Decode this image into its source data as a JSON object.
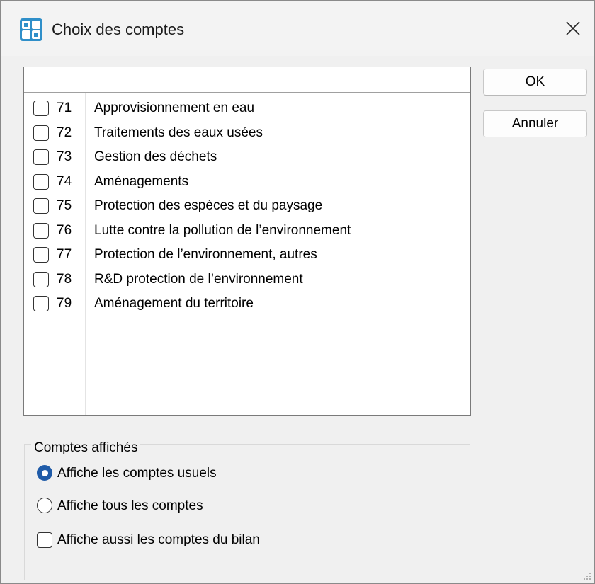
{
  "window": {
    "title": "Choix des comptes"
  },
  "accounts": [
    {
      "num": "71",
      "label": "Approvisionnement en eau",
      "checked": false
    },
    {
      "num": "72",
      "label": "Traitements des eaux usées",
      "checked": false
    },
    {
      "num": "73",
      "label": "Gestion des déchets",
      "checked": false
    },
    {
      "num": "74",
      "label": "Aménagements",
      "checked": false
    },
    {
      "num": "75",
      "label": "Protection des espèces et du paysage",
      "checked": false
    },
    {
      "num": "76",
      "label": "Lutte contre la pollution de l’environnement",
      "checked": false
    },
    {
      "num": "77",
      "label": "Protection de l’environnement, autres",
      "checked": false
    },
    {
      "num": "78",
      "label": "R&D protection de l’environnement",
      "checked": false
    },
    {
      "num": "79",
      "label": "Aménagement du territoire",
      "checked": false
    }
  ],
  "buttons": {
    "ok": "OK",
    "cancel": "Annuler"
  },
  "display_group": {
    "legend": "Comptes affichés",
    "radio_usual": "Affiche les comptes usuels",
    "radio_all": "Affiche tous les comptes",
    "checkbox_balance": "Affiche aussi les comptes du bilan",
    "selected": "usual",
    "balance_checked": false
  },
  "colors": {
    "accent": "#1f5ba8",
    "window_bg": "#f0f0f0"
  }
}
